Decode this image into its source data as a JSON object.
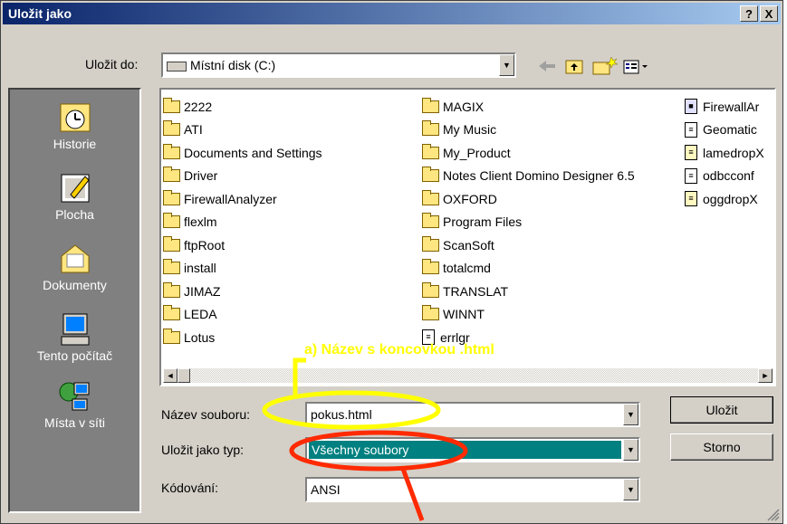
{
  "dialog": {
    "title": "Uložit jako",
    "help_label": "?",
    "close_label": "X"
  },
  "location": {
    "label": "Uložit do:",
    "value": "Místní disk (C:)"
  },
  "places": [
    {
      "label": "Historie",
      "icon": "history-icon"
    },
    {
      "label": "Plocha",
      "icon": "desktop-icon"
    },
    {
      "label": "Dokumenty",
      "icon": "documents-icon"
    },
    {
      "label": "Tento počítač",
      "icon": "computer-icon"
    },
    {
      "label": "Místa v síti",
      "icon": "network-icon"
    }
  ],
  "files": {
    "col1": [
      "2222",
      "ATI",
      "Documents and Settings",
      "Driver",
      "FirewallAnalyzer",
      "flexlm",
      "ftpRoot",
      "install",
      "JIMAZ",
      "LEDA",
      "Lotus"
    ],
    "col2": [
      "MAGIX",
      "My Music",
      "My_Product",
      "Notes Client Domino Designer 6.5",
      "OXFORD",
      "Program Files",
      "ScanSoft",
      "totalcmd",
      "TRANSLAT",
      "WINNT",
      "errlgr"
    ],
    "col3": [
      "FirewallAr",
      "Geomatic",
      "lamedropX",
      "odbcconf",
      "oggdropX"
    ]
  },
  "fields": {
    "filename_label": "Název souboru:",
    "filename_value": "pokus.html",
    "type_label": "Uložit jako typ:",
    "type_value": "Všechny soubory",
    "encoding_label": "Kódování:",
    "encoding_value": "ANSI"
  },
  "buttons": {
    "save": "Uložit",
    "cancel": "Storno"
  },
  "annotation": {
    "text": "a) Název s koncovkou .html",
    "color": "#ffff00",
    "color2": "#ff2a00"
  }
}
